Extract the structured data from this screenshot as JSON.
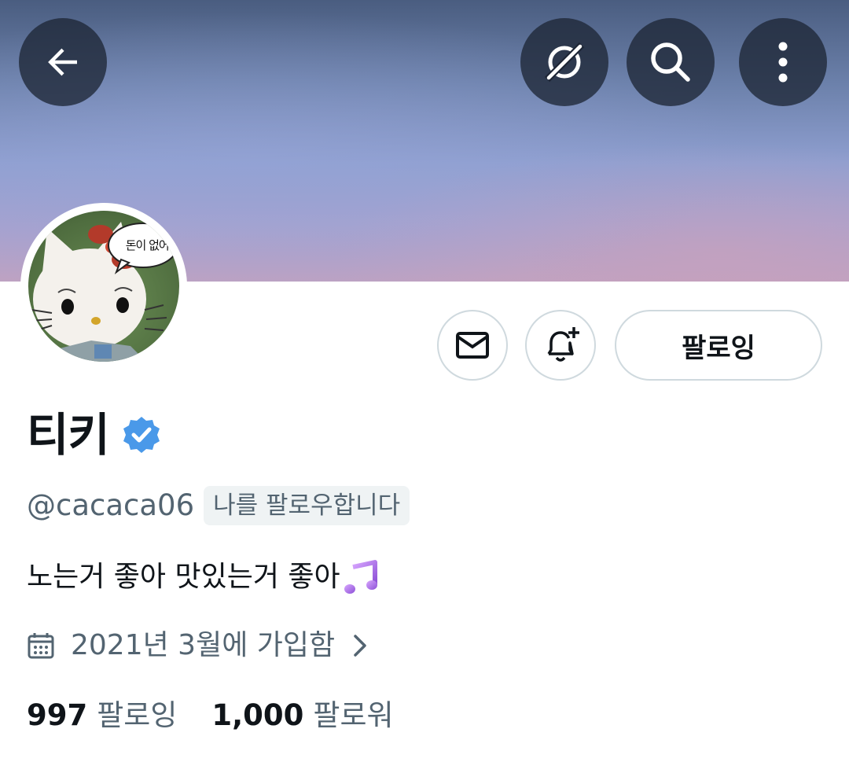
{
  "profile": {
    "display_name": "티키",
    "handle": "@cacaca06",
    "follows_you_badge": "나를 팔로우합니다",
    "bio": "노는거 좋아 맛있는거 좋아",
    "bio_emoji": "musical-notes-emoji",
    "joined": "2021년 3월에 가입함",
    "avatar_caption": "돈이 없어..",
    "verified_color": "#4a99e9"
  },
  "actions": {
    "following_label": "팔로잉"
  },
  "stats": {
    "following_count": "997",
    "following_label": "팔로잉",
    "followers_count": "1,000",
    "followers_label": "팔로워"
  },
  "icons": {
    "back": "back-arrow-icon",
    "grok": "grok-icon",
    "search": "search-icon",
    "more": "more-vertical-icon",
    "message": "mail-icon",
    "notify": "bell-plus-icon",
    "calendar": "calendar-icon",
    "chevron": "chevron-right-icon"
  }
}
